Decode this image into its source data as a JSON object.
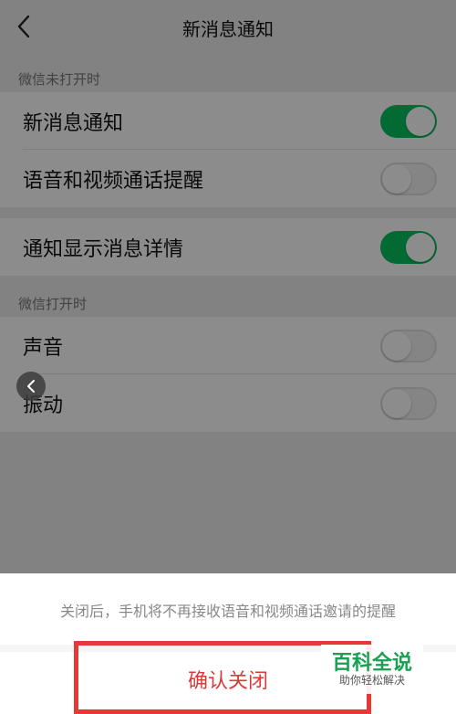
{
  "header": {
    "title": "新消息通知"
  },
  "sections": [
    {
      "header": "微信未打开时",
      "rows": [
        {
          "label": "新消息通知",
          "on": true
        },
        {
          "label": "语音和视频通话提醒",
          "on": false
        }
      ]
    },
    {
      "header": "",
      "rows": [
        {
          "label": "通知显示消息详情",
          "on": true
        }
      ]
    },
    {
      "header": "微信打开时",
      "rows": [
        {
          "label": "声音",
          "on": false
        },
        {
          "label": "振动",
          "on": false
        }
      ]
    }
  ],
  "sheet": {
    "message": "关闭后，手机将不再接收语音和视频通话邀请的提醒",
    "confirm_label": "确认关闭"
  },
  "watermark": {
    "title": "百科全说",
    "subtitle": "助你轻松解决"
  },
  "icons": {
    "back": "chevron-left-icon",
    "float": "chevron-left-icon"
  },
  "colors": {
    "toggle_on": "#07c160",
    "confirm_text": "#d93b3b",
    "highlight_border": "#e53935"
  }
}
